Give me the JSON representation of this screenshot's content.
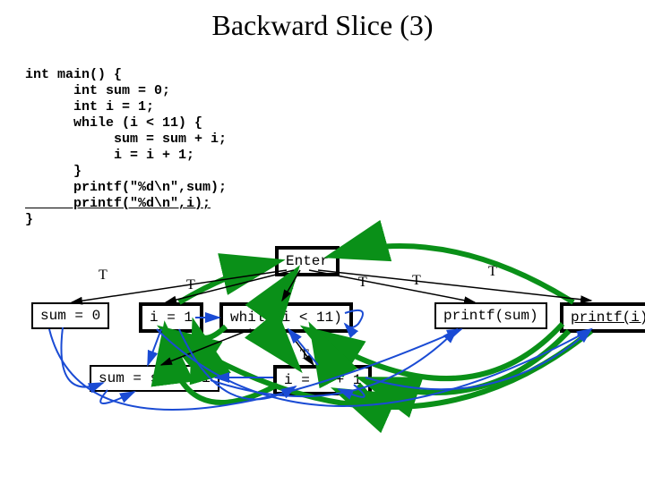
{
  "title": "Backward Slice (3)",
  "code": {
    "line1": "int main() {",
    "line2": "      int sum = 0;",
    "line3": "      int i = 1;",
    "line4": "      while (i < 11) {",
    "line5": "           sum = sum + i;",
    "line6": "           i = i + 1;",
    "line7": "      }",
    "line8": "      printf(\"%d\\n\",sum);",
    "line9": "      printf(\"%d\\n\",i);",
    "line10": "}"
  },
  "nodes": {
    "enter": "Enter",
    "sum0": "sum = 0",
    "i1": "i = 1",
    "while": "while(i < 11)",
    "printfsum": "printf(sum)",
    "printfi": "printf(i)",
    "suminc": "sum = sum + i",
    "iinc": "i = i + 1"
  },
  "labels": {
    "T": "T"
  }
}
